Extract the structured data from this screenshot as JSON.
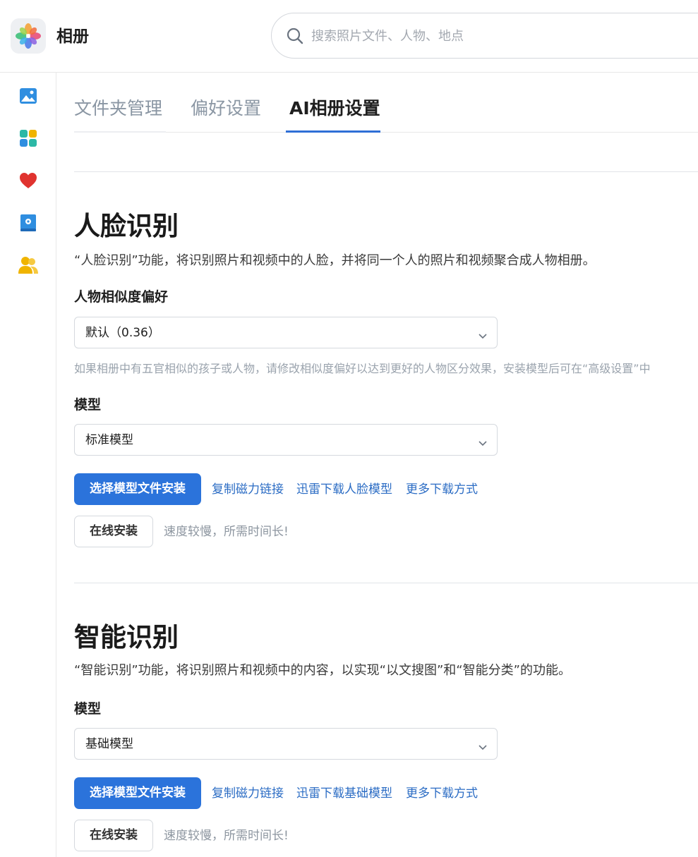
{
  "app": {
    "title": "相册"
  },
  "search": {
    "placeholder": "搜索照片文件、人物、地点"
  },
  "sidebar": {
    "items": [
      {
        "icon": "photos-icon",
        "color": "#2f8ee0"
      },
      {
        "icon": "apps-icon",
        "color": "#2cb8a6"
      },
      {
        "icon": "heart-icon",
        "color": "#e0332f"
      },
      {
        "icon": "album-book-icon",
        "color": "#2f8ee0"
      },
      {
        "icon": "people-icon",
        "color": "#f0b400"
      }
    ]
  },
  "tabs": [
    {
      "label": "文件夹管理",
      "active": false
    },
    {
      "label": "偏好设置",
      "active": false
    },
    {
      "label": "AI相册设置",
      "active": true
    }
  ],
  "face": {
    "title": "人脸识别",
    "desc": "“人脸识别”功能，将识别照片和视频中的人脸，并将同一个人的照片和视频聚合成人物相册。",
    "similarity_label": "人物相似度偏好",
    "similarity_value": "默认（0.36）",
    "similarity_hint": "如果相册中有五官相似的孩子或人物，请修改相似度偏好以达到更好的人物区分效果，安装模型后可在“高级设置”中",
    "model_label": "模型",
    "model_value": "标准模型",
    "install_button": "选择模型文件安装",
    "links": [
      "复制磁力链接",
      "迅雷下载人脸模型",
      "更多下载方式"
    ],
    "online_button": "在线安装",
    "online_note": "速度较慢，所需时间长!"
  },
  "smart": {
    "title": "智能识别",
    "desc": "“智能识别”功能，将识别照片和视频中的内容，以实现“以文搜图”和“智能分类”的功能。",
    "model_label": "模型",
    "model_value": "基础模型",
    "install_button": "选择模型文件安装",
    "links": [
      "复制磁力链接",
      "迅雷下载基础模型",
      "更多下载方式"
    ],
    "online_button": "在线安装",
    "online_note": "速度较慢，所需时间长!"
  },
  "colors": {
    "accent": "#2b73db",
    "link": "#2b6cc4",
    "tab_inactive": "#8a96a3"
  }
}
